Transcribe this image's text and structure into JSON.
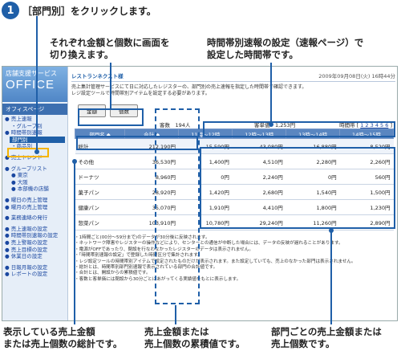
{
  "step": {
    "number": "1",
    "instruction": "［部門別］をクリックします。"
  },
  "callouts": {
    "top_left": [
      "それぞれ金額と個数に画面を",
      "切り換えます。"
    ],
    "top_right": [
      "時間帯別速報の設定（速報ページ）で",
      "設定した時間帯です。"
    ],
    "bottom_left": [
      "表示している売上金額",
      "または売上個数の総計です。"
    ],
    "bottom_center": [
      "売上金額または",
      "売上個数の累積値です。"
    ],
    "bottom_right": [
      "部門ごとの売上金額または",
      "売上個数です。"
    ]
  },
  "app": {
    "logo_sub": "店舗支援サービス",
    "logo_main": "OFFICE",
    "sidebar_header": "オフィスページ",
    "nav": [
      {
        "label": "● 売上速報",
        "type": "item"
      },
      {
        "label": "・グループ別",
        "type": "sub"
      },
      {
        "label": "● 時間帯別速報",
        "type": "item"
      },
      {
        "label": "部門別",
        "type": "selected"
      },
      {
        "label": "・商品別",
        "type": "sub"
      },
      {
        "label": "● 売上トレンド",
        "type": "gap"
      },
      {
        "label": "● グループリスト",
        "type": "gap"
      },
      {
        "label": "● 東京",
        "type": "sub"
      },
      {
        "label": "● 大阪",
        "type": "sub"
      },
      {
        "label": "● 本部機の店舗",
        "type": "sub"
      },
      {
        "label": "● 曜日の売上管理",
        "type": "gap"
      },
      {
        "label": "● 曜月の売上管理",
        "type": "item"
      },
      {
        "label": "● 業務連絡の発行",
        "type": "gap"
      },
      {
        "label": "● 売上速報の設定",
        "type": "gap"
      },
      {
        "label": "● 時間帯別速報の設定",
        "type": "item"
      },
      {
        "label": "● 売上警報の設定",
        "type": "item"
      },
      {
        "label": "● 売上目標の設定",
        "type": "item"
      },
      {
        "label": "● 休業日の設定",
        "type": "item"
      },
      {
        "label": "● 日報月報の設定",
        "type": "gap"
      },
      {
        "label": "● レポートの設定",
        "type": "item"
      }
    ],
    "shop_name": "レストランネクスト様",
    "datetime": "2009年09月08日(火) 16時44分",
    "note_lines": [
      "売上集計管理サービスにて日に対応したレジスターの、部門別の売上速報を指定した時間帯で確認できます。",
      "レジ設定ツールで時間帯別アイテムを設定する必要があります。"
    ],
    "btn_amount": "金額",
    "btn_count": "個数",
    "count_label": "客数　194人",
    "customer_price": "客単価　1,253円",
    "timezone_label": "時間帯",
    "timezone_pages": "1 2 3 4 5 6",
    "table": {
      "headers": [
        "部門名 ◆",
        "合計 ◆",
        "11時〜12時",
        "12時〜13時",
        "13時〜14時",
        "14時〜15時"
      ],
      "rows": [
        {
          "name": "総計",
          "total": "212,190円",
          "t1": "15,590円",
          "t2": "43,080円",
          "t3": "16,880円",
          "t4": "8,520円",
          "is_total": true
        },
        {
          "name": "その他",
          "total": "36,530円",
          "t1": "1,400円",
          "t2": "4,510円",
          "t3": "2,280円",
          "t4": "2,260円"
        },
        {
          "name": "ドーナツ",
          "total": "8,960円",
          "t1": "0円",
          "t2": "2,240円",
          "t3": "0円",
          "t4": "560円"
        },
        {
          "name": "菓子パン",
          "total": "28,920円",
          "t1": "1,420円",
          "t2": "2,680円",
          "t3": "1,540円",
          "t4": "1,500円"
        },
        {
          "name": "健康パン",
          "total": "35,070円",
          "t1": "1,910円",
          "t2": "4,410円",
          "t3": "1,800円",
          "t4": "1,230円"
        },
        {
          "name": "惣菜パン",
          "total": "103,910円",
          "t1": "10,780円",
          "t2": "29,240円",
          "t3": "11,260円",
          "t4": "2,890円"
        }
      ]
    },
    "footnotes": [
      "・1時間ごと(00分〜59分まで)のデータが30分後に反映されます。",
      "・ネットワーク障害やレジスターの操作などにより、センターとの通信が中断した場合には、データの反映が遅れることがあります。",
      "・電源がOFFであったり、閉設を行なわなかったレジスターのデータは表示されません。",
      "・「時間帯別速報の設定」で登録した時間区分で集計されます。",
      "・レジ設定ツールの時間帯別アイテムで設定されたものだけが表示されます。また設定していても、売上のなかった部門は表示されません。",
      "・総計とは、時間帯別部門別速報で表示されている部門の合計値です。",
      "・合計とは、開設からの累積値です。",
      "・客数と客単価には閉設から30分ごとにあがってくる実績値をもとに表示します。"
    ]
  }
}
